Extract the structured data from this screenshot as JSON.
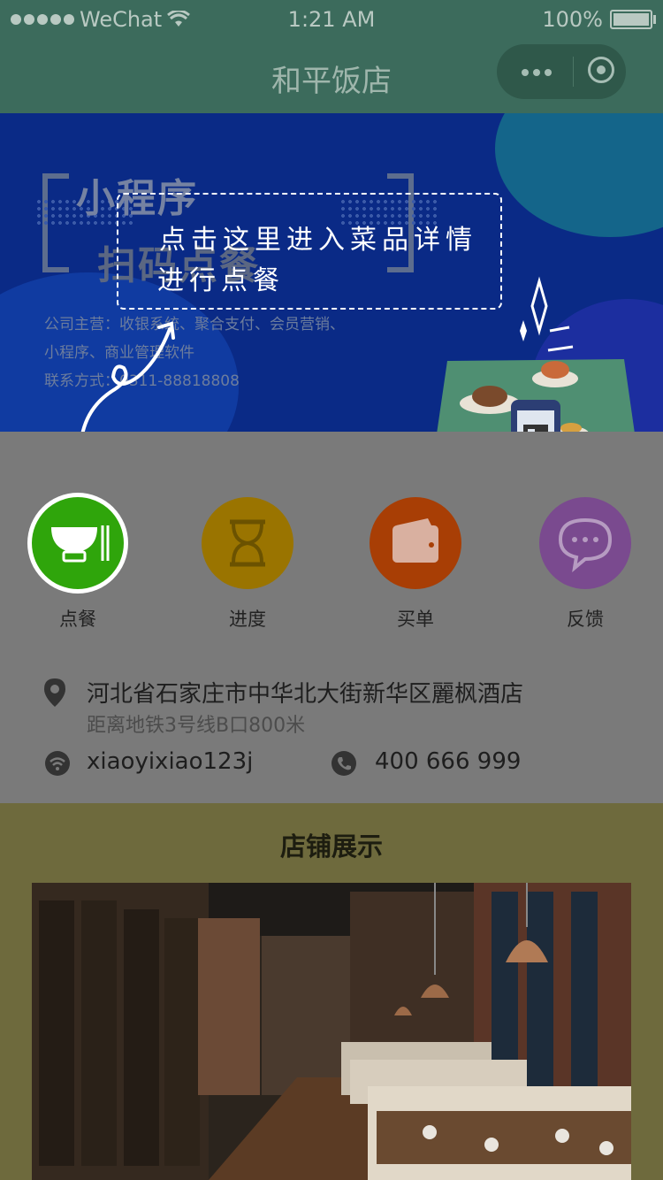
{
  "status_bar": {
    "carrier": "WeChat",
    "time": "1:21 AM",
    "battery": "100%"
  },
  "nav": {
    "title": "和平饭店"
  },
  "banner": {
    "heading_line1": "小程序",
    "heading_line2": "扫码点餐",
    "cta_line1": "点击这里进入菜品详情",
    "cta_line2": "进行点餐",
    "business_line1": "公司主营：收银系统、聚合支付、会员营销、",
    "business_line2": "小程序、商业管理软件",
    "contact": "联系方式：0311-88818808"
  },
  "menu": {
    "items": [
      {
        "label": "点餐",
        "icon": "bowl-icon",
        "color": "#2fa50b"
      },
      {
        "label": "进度",
        "icon": "hourglass-icon",
        "color": "#9a7400"
      },
      {
        "label": "买单",
        "icon": "wallet-icon",
        "color": "#a83e05"
      },
      {
        "label": "反馈",
        "icon": "chat-bubble-icon",
        "color": "#7a4a8f"
      }
    ]
  },
  "info": {
    "address": "河北省石家庄市中华北大街新华区麗枫酒店",
    "subway": "距离地铁3号线B口800米",
    "wifi": "xiaoyixiao123j",
    "phone": "400 666 999"
  },
  "store": {
    "title": "店铺展示"
  },
  "colors": {
    "nav_bg": "#3c6b5c",
    "banner_bg": "#0a2a86",
    "store_bg": "#6e6a3d",
    "overlay_gray": "#7a7a7a"
  }
}
